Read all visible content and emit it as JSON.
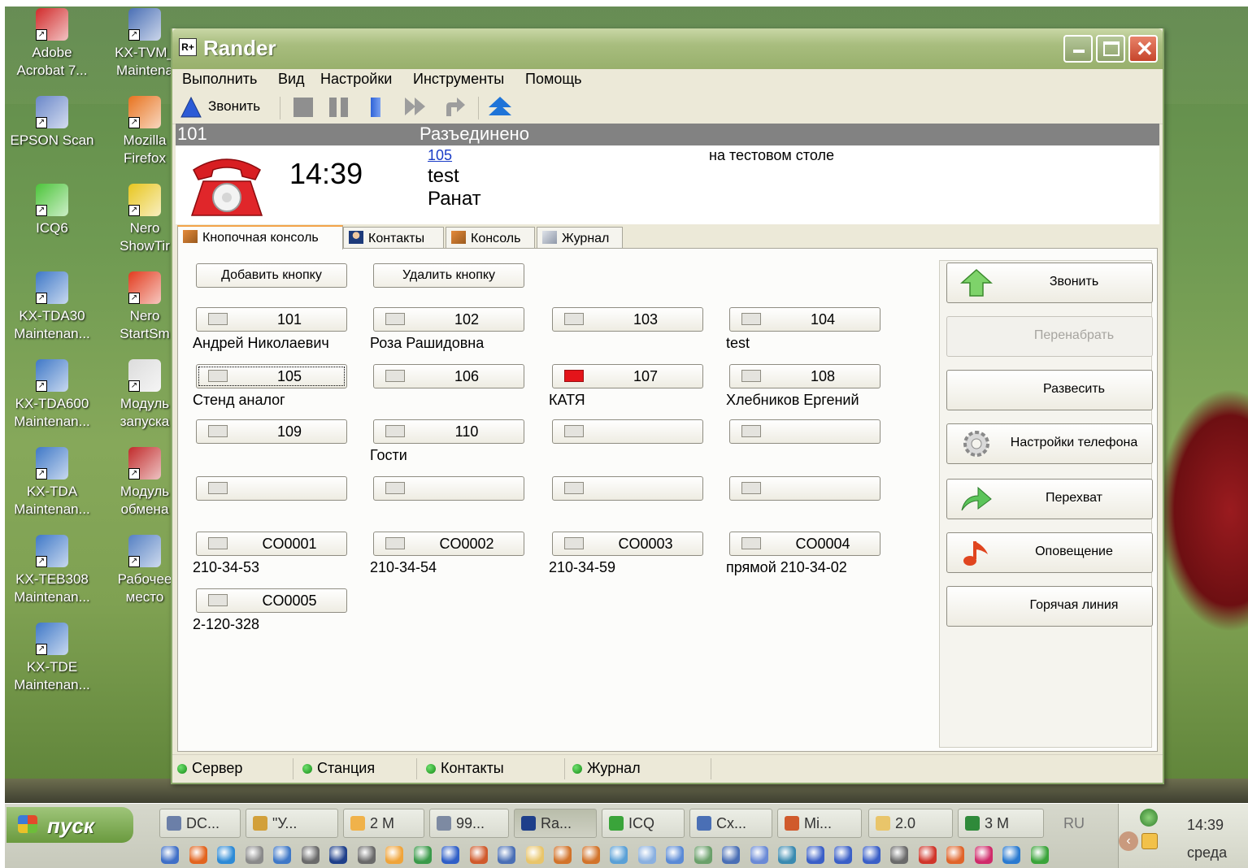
{
  "desktop": {
    "icons": [
      {
        "label": "Adobe\nAcrobat 7...",
        "icon": "pdf-icon",
        "color": "#d12b2b"
      },
      {
        "label": "KX-TVM_\nMaintena",
        "icon": "monitor-icon",
        "color": "#4a6fb5"
      },
      {
        "label": "EPSON Scan",
        "icon": "scanner-icon",
        "color": "#6a87c9"
      },
      {
        "label": "Mozilla\nFirefox",
        "icon": "firefox-icon",
        "color": "#e8731f"
      },
      {
        "label": "ICQ6",
        "icon": "icq-flower-icon",
        "color": "#4cc43a"
      },
      {
        "label": "Nero\nShowTir",
        "icon": "nero-disc-icon",
        "color": "#e8c61f"
      },
      {
        "label": "KX-TDA30\nMaintenan...",
        "icon": "pbx-console-icon",
        "color": "#3f78c7"
      },
      {
        "label": "Nero\nStartSm",
        "icon": "nero-flame-icon",
        "color": "#e23c1f"
      },
      {
        "label": "KX-TDA600\nMaintenan...",
        "icon": "pbx-console-icon",
        "color": "#3f78c7"
      },
      {
        "label": "Модуль\nзапуска",
        "icon": "stopwatch-icon",
        "color": "#dcdcdc"
      },
      {
        "label": "KX-TDA\nMaintenan...",
        "icon": "pbx-console-icon",
        "color": "#3f78c7"
      },
      {
        "label": "Модуль\nобмена",
        "icon": "exchange-module-icon",
        "color": "#c12b2b"
      },
      {
        "label": "KX-TEB308\nMaintenan...",
        "icon": "pbx-console-icon",
        "color": "#3f78c7"
      },
      {
        "label": "Рабочее\nместо",
        "icon": "workstation-doc-icon",
        "color": "#5580c3"
      },
      {
        "label": "KX-TDE\nMaintenan...",
        "icon": "pbx-console-icon",
        "color": "#3f78c7"
      }
    ]
  },
  "window": {
    "title": "Rander",
    "app_icon_text": "R+",
    "menu": [
      "Выполнить",
      "Вид",
      "Настройки",
      "Инструменты",
      "Помощь"
    ],
    "toolbar": {
      "call_label": "Звонить",
      "buttons": [
        "stop-icon",
        "pause-icon",
        "hold-icon",
        "forward-icon",
        "redirect-icon",
        "pickup-icon"
      ]
    },
    "status": {
      "extension": "101",
      "state": "Разъединено"
    },
    "call": {
      "time": "14:39",
      "number": "105",
      "name1": "test",
      "name2": "Ранат",
      "note": "на тестовом столе"
    },
    "tabs": [
      "Кнопочная консоль",
      "Контакты",
      "Консоль",
      "Журнал"
    ],
    "console": {
      "add_button": "Добавить кнопку",
      "remove_button": "Удалить кнопку",
      "keys": [
        {
          "num": "101",
          "label": "Андрей Николаевич",
          "led": "off"
        },
        {
          "num": "102",
          "label": "Роза Рашидовна",
          "led": "off"
        },
        {
          "num": "103",
          "label": "",
          "led": "off"
        },
        {
          "num": "104",
          "label": "test",
          "led": "off"
        },
        {
          "num": "105",
          "label": "Стенд аналог",
          "led": "off",
          "focus": true
        },
        {
          "num": "106",
          "label": "",
          "led": "off"
        },
        {
          "num": "107",
          "label": "КАТЯ",
          "led": "red"
        },
        {
          "num": "108",
          "label": "Хлебников Ергений",
          "led": "off"
        },
        {
          "num": "109",
          "label": "",
          "led": "off"
        },
        {
          "num": "110",
          "label": "Гости",
          "led": "off"
        },
        {
          "num": "",
          "label": "",
          "led": "off"
        },
        {
          "num": "",
          "label": "",
          "led": "off"
        },
        {
          "num": "",
          "label": "",
          "led": "off"
        },
        {
          "num": "",
          "label": "",
          "led": "off"
        },
        {
          "num": "",
          "label": "",
          "led": "off"
        },
        {
          "num": "",
          "label": "",
          "led": "off"
        },
        {
          "num": "CO0001",
          "label": "210-34-53",
          "led": "off"
        },
        {
          "num": "CO0002",
          "label": "210-34-54",
          "led": "off"
        },
        {
          "num": "CO0003",
          "label": "210-34-59",
          "led": "off"
        },
        {
          "num": "CO0004",
          "label": "прямой 210-34-02",
          "led": "off"
        },
        {
          "num": "CO0005",
          "label": "2-120-328",
          "led": "off"
        }
      ]
    },
    "side_buttons": [
      {
        "label": "Звонить",
        "icon": "up-arrow-icon",
        "enabled": true
      },
      {
        "label": "Перенабрать",
        "icon": "",
        "enabled": false
      },
      {
        "label": "Развесить",
        "icon": "",
        "enabled": true
      },
      {
        "label": "Настройки телефона",
        "icon": "gear-icon",
        "enabled": true
      },
      {
        "label": "Перехват",
        "icon": "intercept-arrow-icon",
        "enabled": true
      },
      {
        "label": "Оповещение",
        "icon": "music-note-icon",
        "enabled": true
      },
      {
        "label": "Горячая линия",
        "icon": "",
        "enabled": true
      }
    ],
    "bottom_status": [
      "Сервер",
      "Станция",
      "Контакты",
      "Журнал"
    ]
  },
  "taskbar": {
    "start_label": "пуск",
    "tasks": [
      "DC...",
      "\"У...",
      "2 М",
      "99...",
      "Ra...",
      "ICQ",
      "Сх...",
      "Mi...",
      "2.0",
      "3 М"
    ],
    "lang": "RU",
    "clock": "14:39",
    "day": "среда"
  },
  "colors": {
    "title_green": "#a8bd7e",
    "status_gray": "#828282",
    "led_red": "#e4141a",
    "link_blue": "#1a3cc7",
    "tab_accent": "#f3a34a"
  }
}
